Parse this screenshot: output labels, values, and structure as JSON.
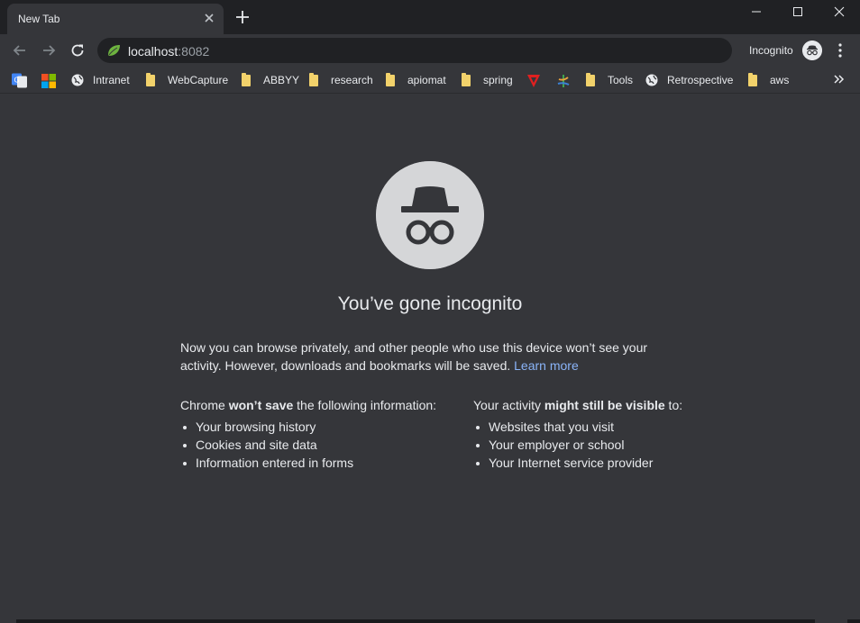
{
  "tab": {
    "title": "New Tab"
  },
  "omnibox": {
    "host": "localhost",
    "port": ":8082"
  },
  "profile": {
    "label": "Incognito"
  },
  "bookmarks": {
    "items": [
      {
        "label": "Intranet",
        "icon": "globe-icon"
      },
      {
        "label": "WebCapture",
        "icon": "folder-icon"
      },
      {
        "label": "ABBYY",
        "icon": "folder-icon"
      },
      {
        "label": "research",
        "icon": "folder-icon"
      },
      {
        "label": "apiomat",
        "icon": "folder-icon"
      },
      {
        "label": "spring",
        "icon": "folder-icon"
      },
      {
        "label": "Tools",
        "icon": "folder-icon"
      },
      {
        "label": "Retrospective",
        "icon": "globe-icon"
      },
      {
        "label": "aws",
        "icon": "folder-icon"
      }
    ]
  },
  "page": {
    "title": "You’ve gone incognito",
    "intro": "Now you can browse privately, and other people who use this device won’t see your activity. However, downloads and bookmarks will be saved.",
    "learn_more": "Learn more",
    "left": {
      "head_pre": "Chrome ",
      "head_bold": "won’t save",
      "head_post": " the following information:",
      "items": [
        "Your browsing history",
        "Cookies and site data",
        "Information entered in forms"
      ]
    },
    "right": {
      "head_pre": "Your activity ",
      "head_bold": "might still be visible",
      "head_post": " to:",
      "items": [
        "Websites that you visit",
        "Your employer or school",
        "Your Internet service provider"
      ]
    }
  },
  "colors": {
    "frame": "#202124",
    "toolbar": "#35363a",
    "link": "#8ab4f8",
    "folder": "#f2d26b"
  }
}
